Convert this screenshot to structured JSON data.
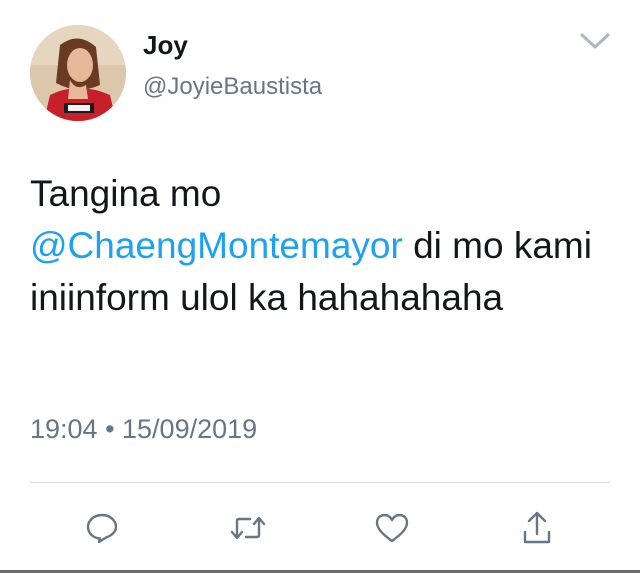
{
  "tweet": {
    "display_name": "Joy",
    "handle": "@JoyieBaustista",
    "text_before": "Tangina mo",
    "mention": "@ChaengMontemayor",
    "text_after": " di mo kami iniinform ulol ka hahahahaha",
    "timestamp": "19:04 • 15/09/2019"
  },
  "icons": {
    "menu": "chevron-down-icon",
    "reply": "speech-bubble-icon",
    "retweet": "retweet-icon",
    "like": "heart-icon",
    "share": "share-icon"
  },
  "colors": {
    "text": "#14171a",
    "secondary": "#657786",
    "mention": "#1da1f2",
    "icon": "#657786"
  }
}
